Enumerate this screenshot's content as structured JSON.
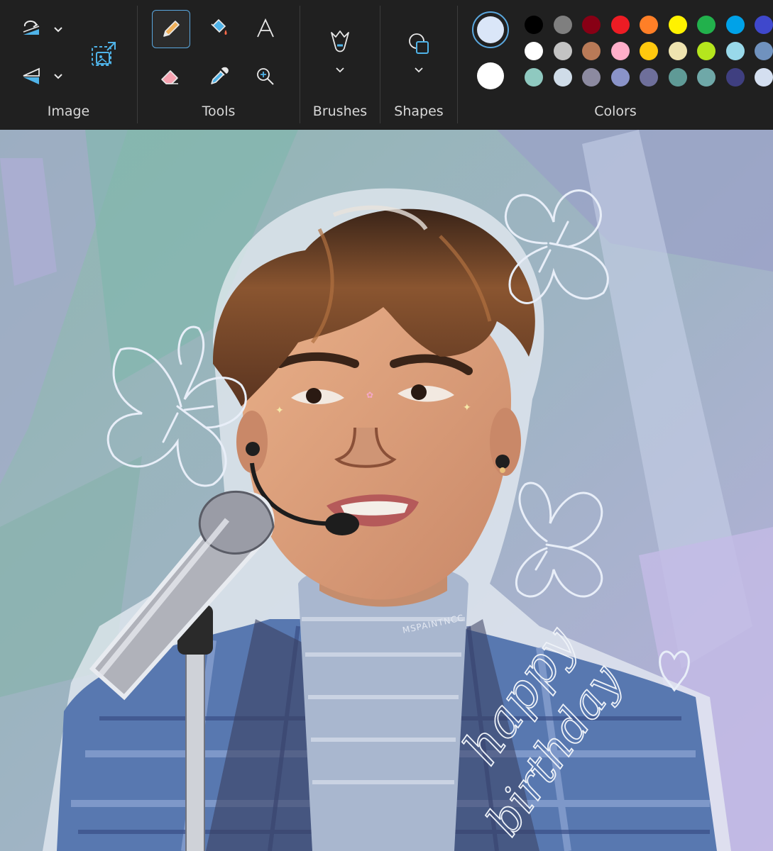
{
  "ribbon": {
    "image_group": {
      "label": "Image",
      "rotate_icon": "rotate-icon",
      "flip_icon": "flip-icon",
      "resize_icon": "resize-icon"
    },
    "tools_group": {
      "label": "Tools",
      "active_tool": "pencil"
    },
    "brushes_group": {
      "label": "Brushes"
    },
    "shapes_group": {
      "label": "Shapes"
    },
    "colors_group": {
      "label": "Colors",
      "primary": "#dae6f8",
      "secondary": "#ffffff",
      "palette": [
        [
          "#000000",
          "#7f7f7f",
          "#880015",
          "#ed1c24",
          "#ff7f27",
          "#fff200",
          "#22b14c",
          "#00a2e8",
          "#3f48cc"
        ],
        [
          "#ffffff",
          "#c3c3c3",
          "#b97a57",
          "#ffaec9",
          "#ffc90e",
          "#efe4b0",
          "#b5e61d",
          "#99d9ea",
          "#7092be"
        ],
        [
          "#8fc9c0",
          "#cfdce8",
          "#8c8aa0",
          "#8a93c8",
          "#6e6f9a",
          "#5f9a96",
          "#6fa8a8",
          "#3f3f80",
          "#d4dff0"
        ]
      ]
    }
  },
  "canvas": {
    "signature": "MSPAINTNCC",
    "handwriting": [
      "happy",
      "birthday"
    ]
  }
}
